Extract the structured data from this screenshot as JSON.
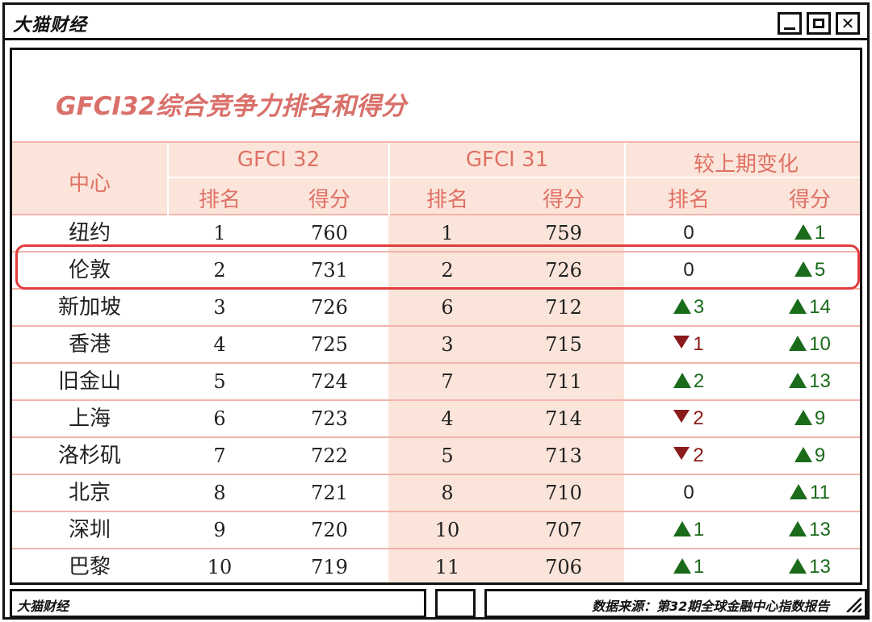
{
  "window": {
    "app_title": "大猫财经",
    "controls": [
      "minimize-icon",
      "maximize-icon",
      "close-icon"
    ]
  },
  "content": {
    "title": "GFCI32综合竞争力排名和得分",
    "header": {
      "center": "中心",
      "groups": [
        "GFCI 32",
        "GFCI 31",
        "较上期变化"
      ],
      "sub": [
        "排名",
        "得分",
        "排名",
        "得分",
        "排名",
        "得分"
      ]
    },
    "rows": [
      {
        "name": "纽约",
        "r32": "1",
        "s32": "760",
        "r31": "1",
        "s31": "759",
        "rank_chg": {
          "dir": "none",
          "val": "0"
        },
        "score_chg": {
          "dir": "up",
          "val": "1"
        }
      },
      {
        "name": "伦敦",
        "r32": "2",
        "s32": "731",
        "r31": "2",
        "s31": "726",
        "rank_chg": {
          "dir": "none",
          "val": "0"
        },
        "score_chg": {
          "dir": "up",
          "val": "5"
        }
      },
      {
        "name": "新加坡",
        "r32": "3",
        "s32": "726",
        "r31": "6",
        "s31": "712",
        "rank_chg": {
          "dir": "up",
          "val": "3"
        },
        "score_chg": {
          "dir": "up",
          "val": "14"
        }
      },
      {
        "name": "香港",
        "r32": "4",
        "s32": "725",
        "r31": "3",
        "s31": "715",
        "rank_chg": {
          "dir": "down",
          "val": "1"
        },
        "score_chg": {
          "dir": "up",
          "val": "10"
        }
      },
      {
        "name": "旧金山",
        "r32": "5",
        "s32": "724",
        "r31": "7",
        "s31": "711",
        "rank_chg": {
          "dir": "up",
          "val": "2"
        },
        "score_chg": {
          "dir": "up",
          "val": "13"
        }
      },
      {
        "name": "上海",
        "r32": "6",
        "s32": "723",
        "r31": "4",
        "s31": "714",
        "rank_chg": {
          "dir": "down",
          "val": "2"
        },
        "score_chg": {
          "dir": "up",
          "val": "9"
        }
      },
      {
        "name": "洛杉矶",
        "r32": "7",
        "s32": "722",
        "r31": "5",
        "s31": "713",
        "rank_chg": {
          "dir": "down",
          "val": "2"
        },
        "score_chg": {
          "dir": "up",
          "val": "9"
        }
      },
      {
        "name": "北京",
        "r32": "8",
        "s32": "721",
        "r31": "8",
        "s31": "710",
        "rank_chg": {
          "dir": "none",
          "val": "0"
        },
        "score_chg": {
          "dir": "up",
          "val": "11"
        }
      },
      {
        "name": "深圳",
        "r32": "9",
        "s32": "720",
        "r31": "10",
        "s31": "707",
        "rank_chg": {
          "dir": "up",
          "val": "1"
        },
        "score_chg": {
          "dir": "up",
          "val": "13"
        }
      },
      {
        "name": "巴黎",
        "r32": "10",
        "s32": "719",
        "r31": "11",
        "s31": "706",
        "rank_chg": {
          "dir": "up",
          "val": "1"
        },
        "score_chg": {
          "dir": "up",
          "val": "13"
        }
      }
    ],
    "highlighted_row": 2
  },
  "footer": {
    "brand": "大猫财经",
    "source": "数据来源：第32期全球金融中心指数报告"
  },
  "colors": {
    "title": "#d9706a",
    "header_bg": "#fbe5da",
    "header_text": "#e07065",
    "up": "#1a6b1a",
    "down": "#8b1a1a",
    "highlight": "#e23c3c"
  }
}
